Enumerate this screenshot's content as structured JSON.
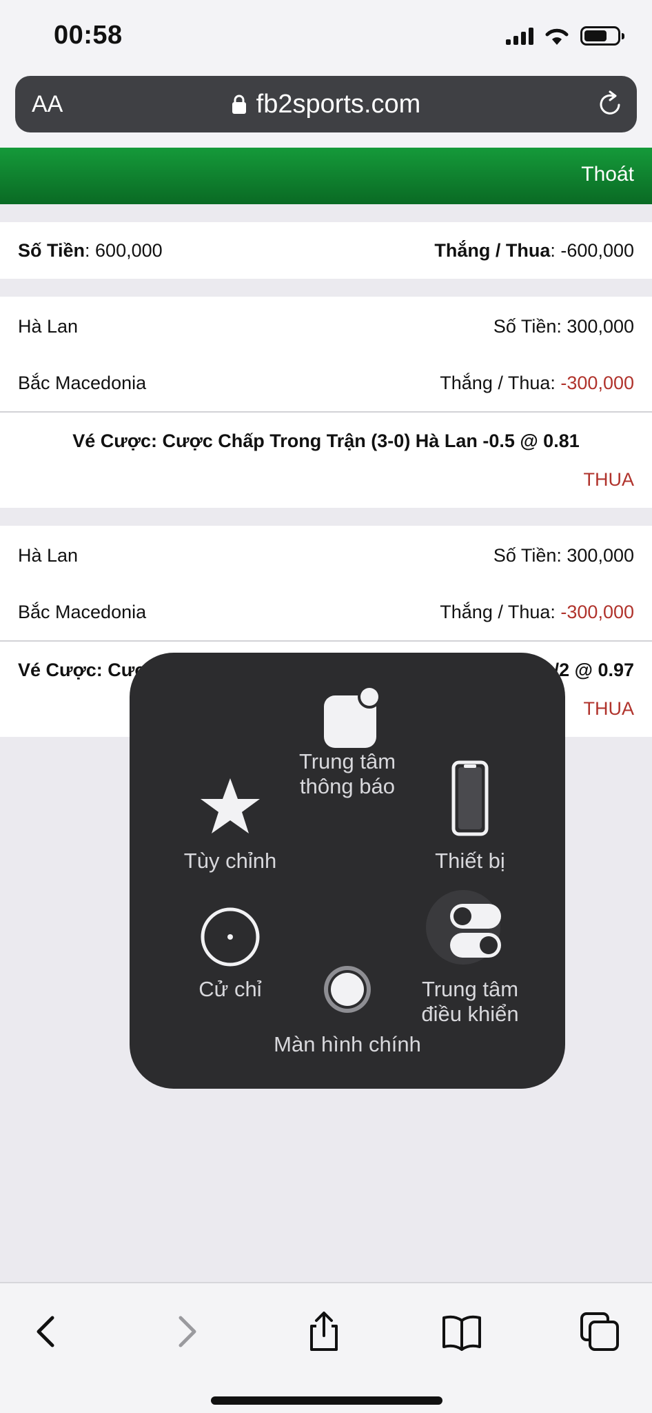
{
  "status_bar": {
    "time": "00:58"
  },
  "address_bar": {
    "aa_label": "AA",
    "url": "fb2sports.com"
  },
  "header": {
    "logout_label": "Thoát"
  },
  "summary": {
    "amount_label": "Số Tiền",
    "amount_value": ": 600,000",
    "winloss_label": "Thắng / Thua",
    "winloss_value": ": -600,000"
  },
  "bets": [
    {
      "home_team": "Hà Lan",
      "away_team": "Bắc Macedonia",
      "amount_text": "Số Tiền: 300,000",
      "winloss_label": "Thắng / Thua: ",
      "winloss_value": "-300,000",
      "ticket": "Vé Cược: Cược Chấp Trong Trận (3-0) Hà Lan -0.5 @ 0.81",
      "result": "THUA"
    },
    {
      "home_team": "Hà Lan",
      "away_team": "Bắc Macedonia",
      "amount_text": "Số Tiền: 300,000",
      "winloss_label": "Thắng / Thua: ",
      "winloss_value": "-300,000",
      "ticket_start": "Vé Cược: Cược",
      "ticket_end": "/2 @ 0.97",
      "result": "THUA"
    }
  ],
  "assistive_menu": {
    "notification_center": [
      "Trung tâm",
      "thông báo"
    ],
    "customize": "Tùy chỉnh",
    "device": "Thiết bị",
    "gestures": "Cử chỉ",
    "control_center": [
      "Trung tâm",
      "điều khiển"
    ],
    "home": "Màn hình chính"
  },
  "colors": {
    "header_green": "#0f8a33",
    "loss_red": "#b0332c",
    "menu_bg": "#2c2c2e"
  },
  "icons": [
    "lock-icon",
    "reload-icon",
    "back-icon",
    "forward-icon",
    "share-icon",
    "bookmarks-icon",
    "tabs-icon",
    "star-icon",
    "phone-icon",
    "gesture-icon",
    "home-button-icon",
    "toggle-icon",
    "notification-icon"
  ]
}
